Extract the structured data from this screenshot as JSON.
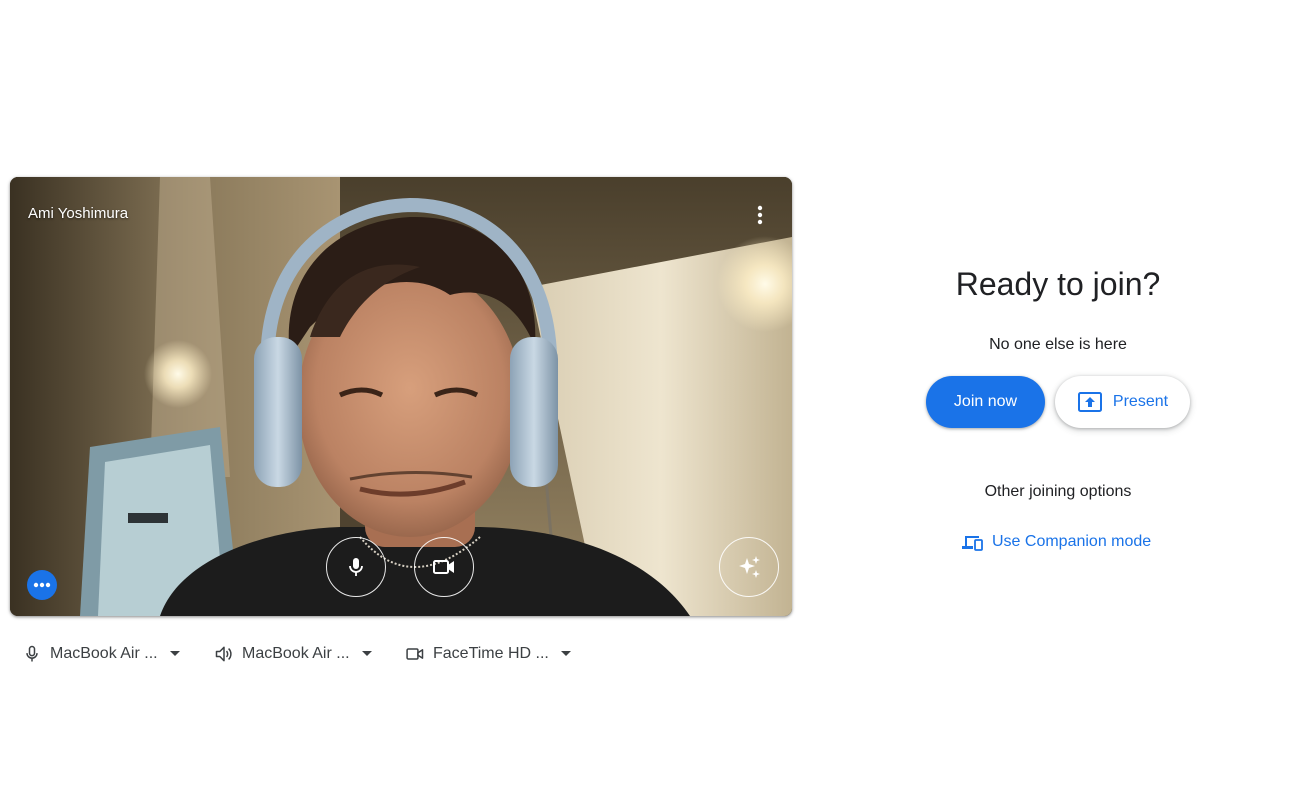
{
  "preview": {
    "participant_name": "Ami Yoshimura",
    "icons": {
      "menu": "more-vert-icon",
      "mic": "microphone-icon",
      "camera": "videocam-icon",
      "effects": "sparkle-icon",
      "options": "more-horiz-icon"
    }
  },
  "devices": {
    "microphone": "MacBook Air ...",
    "speaker": "MacBook Air ...",
    "camera": "FaceTime HD ..."
  },
  "join_panel": {
    "title": "Ready to join?",
    "subtitle": "No one else is here",
    "join_label": "Join now",
    "present_label": "Present",
    "other_options_label": "Other joining options",
    "companion_label": "Use Companion mode"
  },
  "colors": {
    "accent": "#1a73e8",
    "text": "#202124",
    "device_text": "#3c4043"
  }
}
